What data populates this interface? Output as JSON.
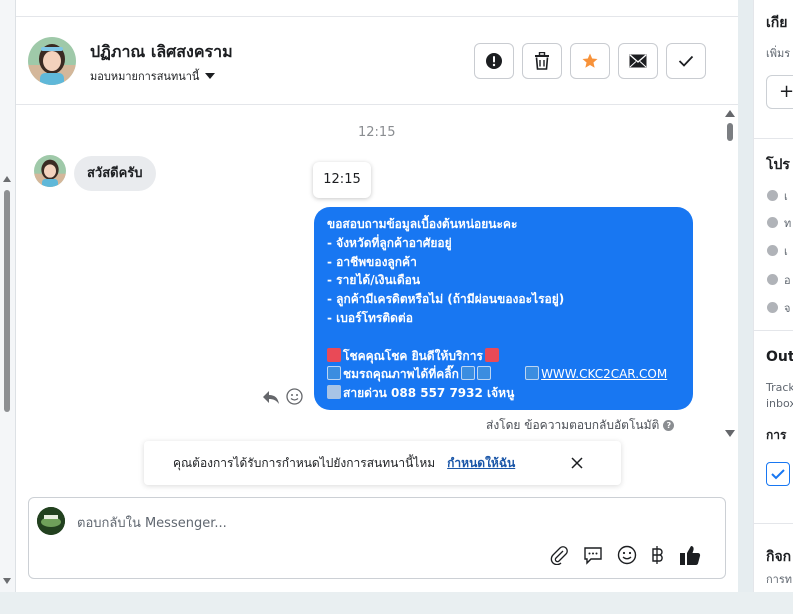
{
  "contact": {
    "name": "ปฏิภาณ เลิศสงคราม",
    "assign_label": "มอบหมายการสนทนานี้"
  },
  "messages": {
    "timestamp": "12:15",
    "hover_timestamp": "12:15",
    "incoming": "สวัสดีครับ",
    "outgoing_lines": [
      "ขอสอบถามข้อมูลเบื้องต้นหน่อยนะคะ",
      "- จังหวัดที่ลูกค้าอาศัยอยู่",
      "- อาชีพของลูกค้า",
      "- รายได้/เงินเดือน",
      "- ลูกค้ามีเครดิตหรือไม่ (ถ้ามีผ่อนของอะไรอยู่)",
      "- เบอร์โทรติดต่อ"
    ],
    "promo_line": "โชคคุณโชค ยินดีให้บริการ",
    "video_line": "ชมรถคุณภาพได้ที่คลิ๊ก",
    "website": "WWW.CKC2CAR.COM",
    "hotline": "สายด่วน 088 557 7932 เจ้หนู",
    "sent_by": "ส่งโดย ข้อความตอบกลับอัตโนมัติ"
  },
  "banner": {
    "text": "คุณต้องการได้รับการกำหนดไปยังการสนทนานี้ไหม",
    "link": "กำหนดให้ฉัน"
  },
  "composer": {
    "placeholder": "ตอบกลับใน Messenger..."
  },
  "right_panel": {
    "section1_title": "เกีย",
    "section1_sub": "เพิ่มร",
    "plus": "+",
    "section2_title": "โปร",
    "row_labels": [
      "เ",
      "ท",
      "เ",
      "อ",
      "จ"
    ],
    "section3_title": "Out",
    "section3_desc": [
      "Track",
      "inbox"
    ],
    "section3_sub": "การ",
    "section4_title": "กิจก",
    "section4_sub": "การท"
  },
  "colors": {
    "accent": "#1877f2",
    "star": "#f7923a",
    "link": "#1a56a8"
  }
}
